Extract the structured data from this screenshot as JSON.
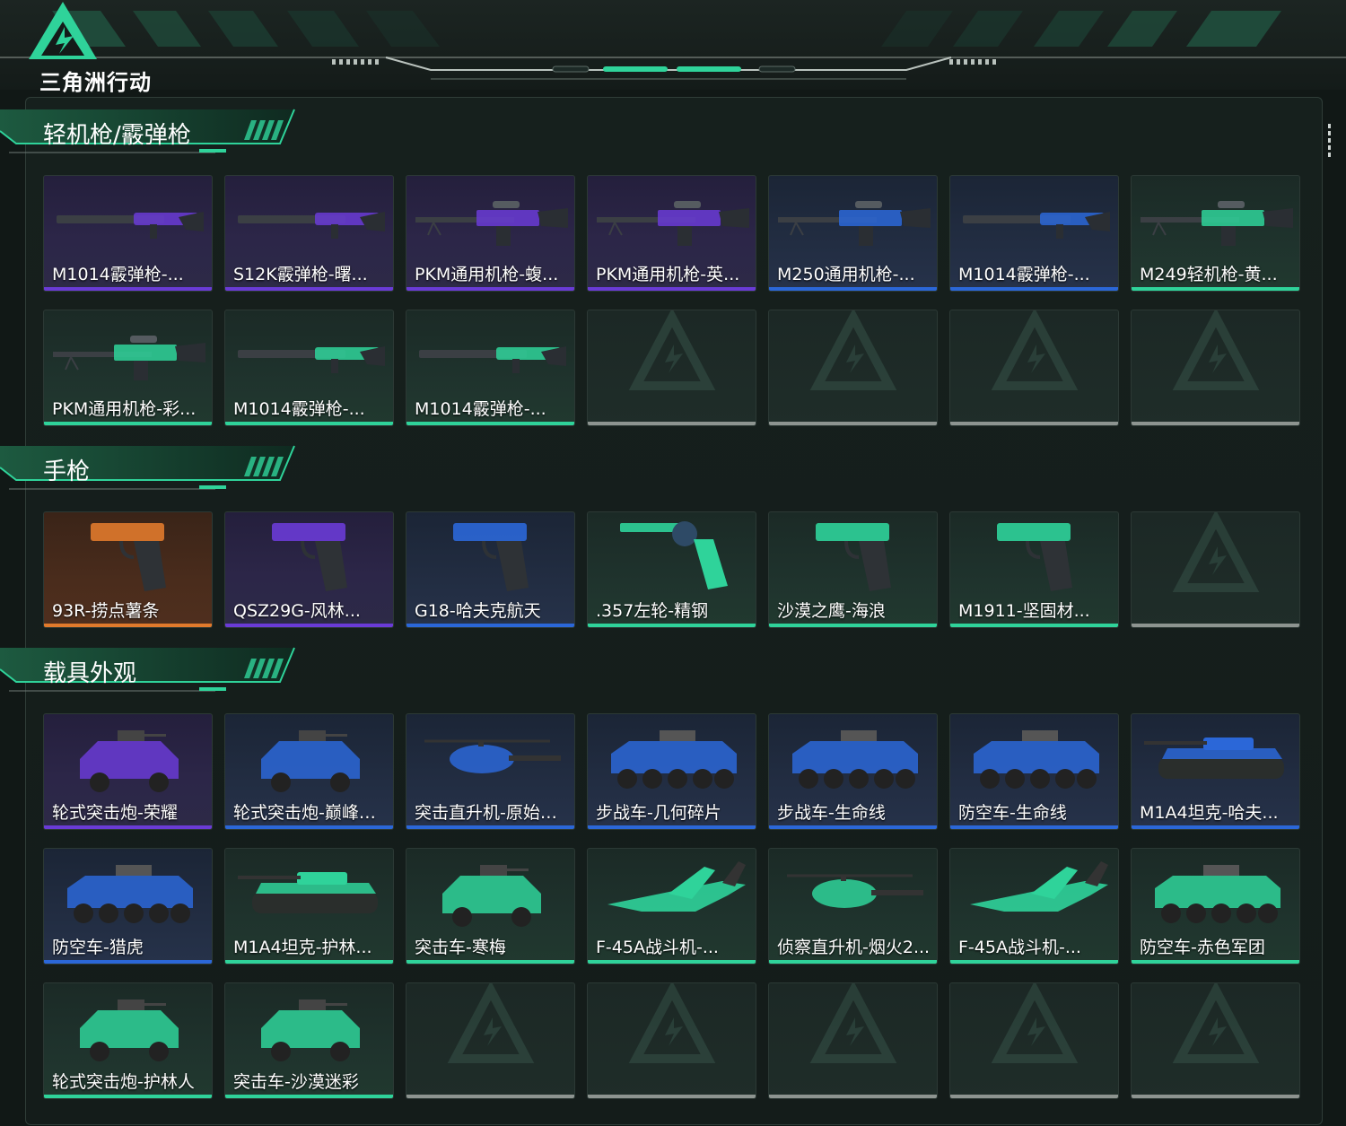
{
  "app": {
    "logo_text": "三角洲行动"
  },
  "sections": [
    {
      "title": "轻机枪/霰弹枪",
      "cards": [
        {
          "label": "M1014霰弹枪-...",
          "quality": "purple",
          "icon": "shotgun-icon"
        },
        {
          "label": "S12K霰弹枪-曙...",
          "quality": "purple",
          "icon": "shotgun-icon"
        },
        {
          "label": "PKM通用机枪-蝮...",
          "quality": "purple",
          "icon": "machine-gun-icon"
        },
        {
          "label": "PKM通用机枪-英...",
          "quality": "purple",
          "icon": "machine-gun-icon"
        },
        {
          "label": "M250通用机枪-...",
          "quality": "blue",
          "icon": "machine-gun-icon"
        },
        {
          "label": "M1014霰弹枪-...",
          "quality": "blue",
          "icon": "shotgun-icon"
        },
        {
          "label": "M249轻机枪-黄...",
          "quality": "green",
          "icon": "machine-gun-icon"
        },
        {
          "label": "PKM通用机枪-彩...",
          "quality": "green",
          "icon": "machine-gun-icon"
        },
        {
          "label": "M1014霰弹枪-...",
          "quality": "green",
          "icon": "shotgun-icon"
        },
        {
          "label": "M1014霰弹枪-...",
          "quality": "green",
          "icon": "shotgun-icon"
        },
        {
          "label": "",
          "quality": "empty",
          "icon": "empty-slot-icon"
        },
        {
          "label": "",
          "quality": "empty",
          "icon": "empty-slot-icon"
        },
        {
          "label": "",
          "quality": "empty",
          "icon": "empty-slot-icon"
        },
        {
          "label": "",
          "quality": "empty",
          "icon": "empty-slot-icon"
        }
      ]
    },
    {
      "title": "手枪",
      "cards": [
        {
          "label": "93R-捞点薯条",
          "quality": "orange",
          "icon": "pistol-icon"
        },
        {
          "label": "QSZ29G-风林...",
          "quality": "purple",
          "icon": "pistol-icon"
        },
        {
          "label": "G18-哈夫克航天",
          "quality": "blue",
          "icon": "pistol-icon"
        },
        {
          "label": ".357左轮-精钢",
          "quality": "green",
          "icon": "revolver-icon"
        },
        {
          "label": "沙漠之鹰-海浪",
          "quality": "green",
          "icon": "pistol-icon"
        },
        {
          "label": "M1911-坚固材...",
          "quality": "green",
          "icon": "pistol-icon"
        },
        {
          "label": "",
          "quality": "empty",
          "icon": "empty-slot-icon"
        }
      ]
    },
    {
      "title": "载具外观",
      "cards": [
        {
          "label": "轮式突击炮-荣耀",
          "quality": "purple",
          "icon": "armored-car-icon"
        },
        {
          "label": "轮式突击炮-巅峰竞...",
          "quality": "blue",
          "icon": "armored-car-icon"
        },
        {
          "label": "突击直升机-原始伪...",
          "quality": "blue",
          "icon": "helicopter-icon"
        },
        {
          "label": "步战车-几何碎片",
          "quality": "blue",
          "icon": "ifv-icon"
        },
        {
          "label": "步战车-生命线",
          "quality": "blue",
          "icon": "ifv-icon"
        },
        {
          "label": "防空车-生命线",
          "quality": "blue",
          "icon": "ifv-icon"
        },
        {
          "label": "M1A4坦克-哈夫...",
          "quality": "blue",
          "icon": "tank-icon"
        },
        {
          "label": "防空车-猎虎",
          "quality": "blue",
          "icon": "ifv-icon"
        },
        {
          "label": "M1A4坦克-护林...",
          "quality": "green",
          "icon": "tank-icon"
        },
        {
          "label": "突击车-寒梅",
          "quality": "green",
          "icon": "armored-car-icon"
        },
        {
          "label": "F-45A战斗机-...",
          "quality": "green",
          "icon": "fighter-jet-icon"
        },
        {
          "label": "侦察直升机-烟火2...",
          "quality": "green",
          "icon": "helicopter-icon"
        },
        {
          "label": "F-45A战斗机-...",
          "quality": "green",
          "icon": "fighter-jet-icon"
        },
        {
          "label": "防空车-赤色军团",
          "quality": "green",
          "icon": "ifv-icon"
        },
        {
          "label": "轮式突击炮-护林人",
          "quality": "green",
          "icon": "armored-car-icon"
        },
        {
          "label": "突击车-沙漠迷彩",
          "quality": "green",
          "icon": "armored-car-icon"
        },
        {
          "label": "",
          "quality": "empty",
          "icon": "empty-slot-icon"
        },
        {
          "label": "",
          "quality": "empty",
          "icon": "empty-slot-icon"
        },
        {
          "label": "",
          "quality": "empty",
          "icon": "empty-slot-icon"
        },
        {
          "label": "",
          "quality": "empty",
          "icon": "empty-slot-icon"
        },
        {
          "label": "",
          "quality": "empty",
          "icon": "empty-slot-icon"
        }
      ]
    }
  ],
  "colors": {
    "accent": "#2fd39a",
    "purple": "#6a3bd6",
    "blue": "#2b67d8",
    "green": "#2fd39a",
    "orange": "#e07a2c",
    "empty": "#8d9490"
  }
}
